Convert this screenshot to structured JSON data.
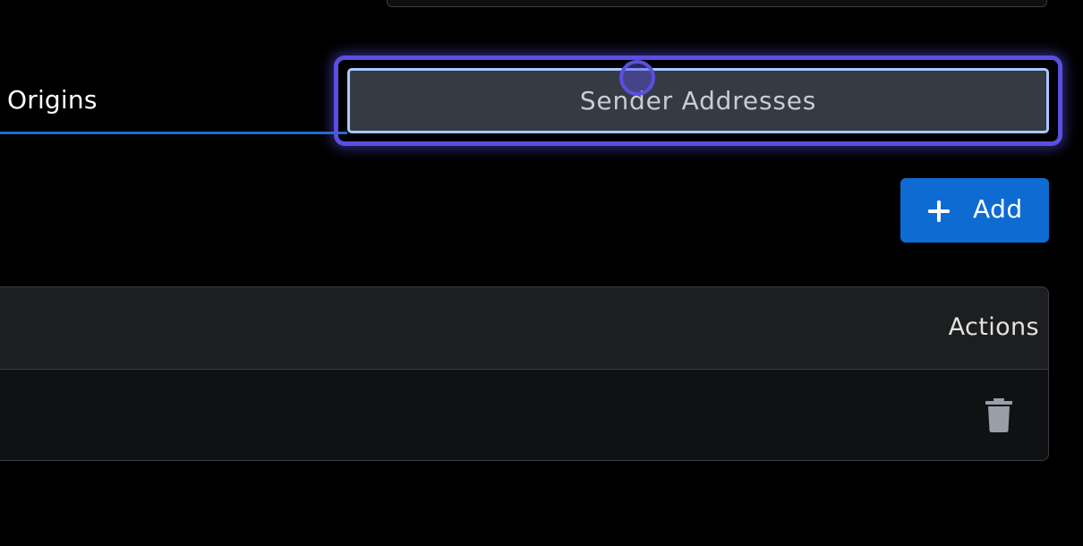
{
  "tabs": {
    "origins_label": "Origins",
    "sender_addresses_label": "Sender Addresses"
  },
  "toolbar": {
    "add_label": "Add",
    "add_icon": "plus-icon"
  },
  "table": {
    "columns": [
      "Actions"
    ],
    "rows": [
      {
        "actions": [
          "trash-icon"
        ]
      }
    ]
  },
  "colors": {
    "accent": "#0e6bd1",
    "tab_underline": "#1c6fd1",
    "focus_ring": "#5a4fe0",
    "active_tab_border": "#a8c8ff"
  }
}
